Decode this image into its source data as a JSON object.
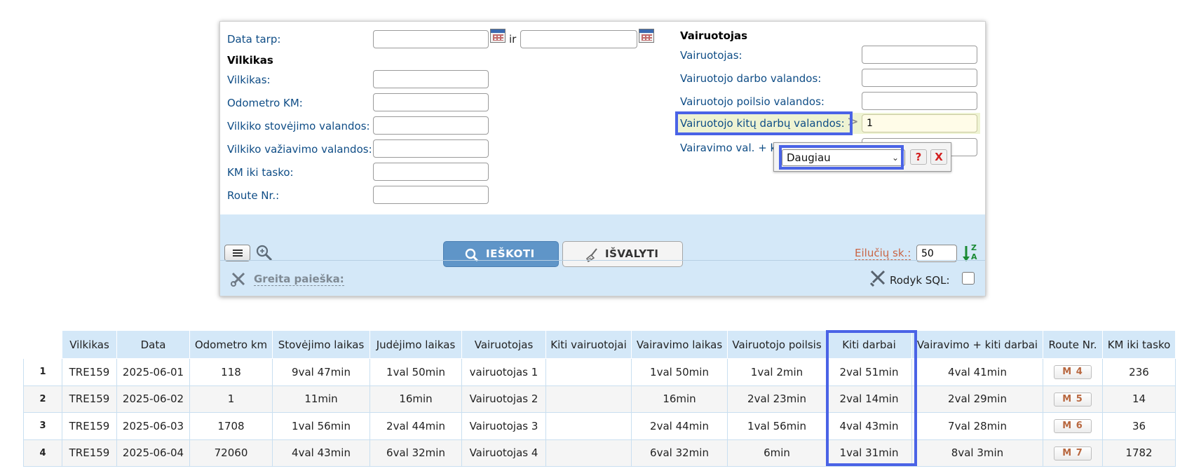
{
  "filter": {
    "date_between_label": "Data tarp:",
    "date_from": "",
    "date_separator": "ir",
    "date_to": "",
    "truck_section": {
      "title": "Vilkikas",
      "fields": [
        {
          "label": "Vilkikas:",
          "value": ""
        },
        {
          "label": "Odometro KM:",
          "value": ""
        },
        {
          "label": "Vilkiko stovėjimo valandos:",
          "value": ""
        },
        {
          "label": "Vilkiko važiavimo valandos:",
          "value": ""
        },
        {
          "label": "KM iki tasko:",
          "value": ""
        },
        {
          "label": "Route Nr.:",
          "value": ""
        }
      ]
    },
    "driver_section": {
      "title": "Vairuotojas",
      "fields": [
        {
          "label": "Vairuotojas:",
          "value": ""
        },
        {
          "label": "Vairuotojo darbo valandos:",
          "value": ""
        },
        {
          "label": "Vairuotojo poilsio valandos:",
          "value": ""
        },
        {
          "label": "Vairuotojo kitų darbų valandos:",
          "operator": ">",
          "value": "1"
        },
        {
          "label": "Vairavimo val. + k",
          "value": ""
        }
      ]
    },
    "operator_popup": {
      "selected": "Daugiau",
      "help_label": "?",
      "close_label": "X"
    }
  },
  "toolbar": {
    "search_label": "IEŠKOTI",
    "clear_label": "IŠVALYTI",
    "rows_label": "Eilučių sk.:",
    "rows_value": "50",
    "sort_glyph_top": "Z",
    "sort_glyph_bottom": "A",
    "quick_search_label": "Greita paieška:",
    "show_sql_label": "Rodyk SQL:"
  },
  "table": {
    "columns": [
      "Vilkikas",
      "Data",
      "Odometro km",
      "Stovėjimo laikas",
      "Judėjimo laikas",
      "Vairuotojas",
      "Kiti vairuotojai",
      "Vairavimo laikas",
      "Vairuotojo poilsis",
      "Kiti darbai",
      "Vairavimo + kiti darbai",
      "Route Nr.",
      "KM iki tasko"
    ],
    "rows": [
      {
        "n": "1",
        "truck": "TRE159",
        "date": "2025-06-01",
        "odo": "118",
        "idle": "9val 47min",
        "move": "1val 50min",
        "driver": "vairuotojas 1",
        "others": "",
        "driving": "1val 50min",
        "rest": "1val 2min",
        "other_work": "2val 51min",
        "drive_plus": "4val 41min",
        "route": "M 4",
        "km": "236"
      },
      {
        "n": "2",
        "truck": "TRE159",
        "date": "2025-06-02",
        "odo": "1",
        "idle": "11min",
        "move": "16min",
        "driver": "Vairuotojas 2",
        "others": "",
        "driving": "16min",
        "rest": "2val 23min",
        "other_work": "2val 14min",
        "drive_plus": "2val 29min",
        "route": "M 5",
        "km": "14"
      },
      {
        "n": "3",
        "truck": "TRE159",
        "date": "2025-06-03",
        "odo": "1708",
        "idle": "1val 56min",
        "move": "2val 44min",
        "driver": "Vairuotojas 3",
        "others": "",
        "driving": "2val 44min",
        "rest": "1val 56min",
        "other_work": "4val 43min",
        "drive_plus": "7val 28min",
        "route": "M 6",
        "km": "36"
      },
      {
        "n": "4",
        "truck": "TRE159",
        "date": "2025-06-04",
        "odo": "72060",
        "idle": "4val 43min",
        "move": "6val 32min",
        "driver": "Vairuotojas 4",
        "others": "",
        "driving": "6val 32min",
        "rest": "6min",
        "other_work": "1val 31min",
        "drive_plus": "8val 3min",
        "route": "M 7",
        "km": "1782"
      }
    ]
  }
}
